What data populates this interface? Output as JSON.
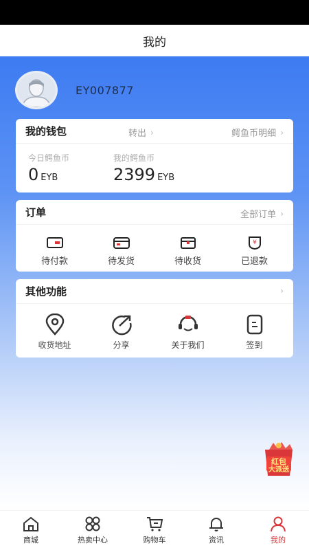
{
  "header": {
    "title": "我的"
  },
  "profile": {
    "username": "EY007877"
  },
  "wallet": {
    "title": "我的钱包",
    "transfer_label": "转出",
    "detail_label": "鳄鱼币明细",
    "today_label": "今日鳄鱼币",
    "today_value": "0",
    "today_unit": "EYB",
    "mine_label": "我的鳄鱼币",
    "mine_value": "2399",
    "mine_unit": "EYB"
  },
  "orders": {
    "title": "订单",
    "all_label": "全部订单",
    "items": [
      {
        "label": "待付款",
        "icon": "wallet-icon"
      },
      {
        "label": "待发货",
        "icon": "card-icon"
      },
      {
        "label": "待收货",
        "icon": "box-icon"
      },
      {
        "label": "已退款",
        "icon": "refund-icon"
      }
    ]
  },
  "other": {
    "title": "其他功能",
    "items": [
      {
        "label": "收货地址",
        "icon": "location-icon"
      },
      {
        "label": "分享",
        "icon": "share-icon"
      },
      {
        "label": "关于我们",
        "icon": "service-icon"
      },
      {
        "label": "签到",
        "icon": "checkin-icon"
      }
    ]
  },
  "promo": {
    "text_line1": "红包",
    "text_line2": "大派送"
  },
  "tabbar": {
    "items": [
      {
        "label": "商城",
        "icon": "home-icon"
      },
      {
        "label": "热卖中心",
        "icon": "grid-icon"
      },
      {
        "label": "购物车",
        "icon": "cart-icon"
      },
      {
        "label": "资讯",
        "icon": "bell-icon"
      },
      {
        "label": "我的",
        "icon": "user-icon"
      }
    ],
    "active_color": "#d9373a"
  },
  "colors": {
    "brand_blue": "#3d7bf2",
    "accent_red": "#d9373a"
  }
}
